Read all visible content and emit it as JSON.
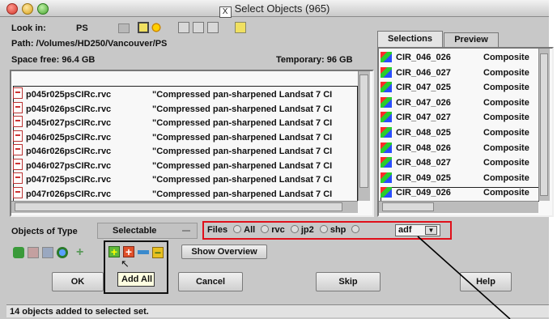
{
  "window": {
    "title": "Select Objects (965)"
  },
  "lookin": {
    "label": "Look in:",
    "value": "PS"
  },
  "path": "Path: /Volumes/HD250/Vancouver/PS",
  "space_free": "Space free: 96.4 GB",
  "temporary": "Temporary: 96 GB",
  "files": [
    {
      "name": "p045r025psCIRc.rvc",
      "desc": "\"Compressed pan-sharpened Landsat 7 CI"
    },
    {
      "name": "p045r026psCIRc.rvc",
      "desc": "\"Compressed pan-sharpened Landsat 7 CI"
    },
    {
      "name": "p045r027psCIRc.rvc",
      "desc": "\"Compressed pan-sharpened Landsat 7 CI"
    },
    {
      "name": "p046r025psCIRc.rvc",
      "desc": "\"Compressed pan-sharpened Landsat 7 CI"
    },
    {
      "name": "p046r026psCIRc.rvc",
      "desc": "\"Compressed pan-sharpened Landsat 7 CI"
    },
    {
      "name": "p046r027psCIRc.rvc",
      "desc": "\"Compressed pan-sharpened Landsat 7 CI"
    },
    {
      "name": "p047r025psCIRc.rvc",
      "desc": "\"Compressed pan-sharpened Landsat 7 CI"
    },
    {
      "name": "p047r026psCIRc.rvc",
      "desc": "\"Compressed pan-sharpened Landsat 7 CI"
    }
  ],
  "tabs": {
    "selections": "Selections",
    "preview": "Preview"
  },
  "selections": [
    {
      "name": "CIR_046_026",
      "type": "Composite"
    },
    {
      "name": "CIR_046_027",
      "type": "Composite"
    },
    {
      "name": "CIR_047_025",
      "type": "Composite"
    },
    {
      "name": "CIR_047_026",
      "type": "Composite"
    },
    {
      "name": "CIR_047_027",
      "type": "Composite"
    },
    {
      "name": "CIR_048_025",
      "type": "Composite"
    },
    {
      "name": "CIR_048_026",
      "type": "Composite"
    },
    {
      "name": "CIR_048_027",
      "type": "Composite"
    },
    {
      "name": "CIR_049_025",
      "type": "Composite"
    },
    {
      "name": "CIR_049_026",
      "type": "Composite"
    }
  ],
  "objects_of_type": {
    "label": "Objects of Type",
    "value": "Selectable"
  },
  "files_filter": {
    "label": "Files",
    "options": [
      "All",
      "rvc",
      "jp2",
      "shp"
    ],
    "custom": "adf"
  },
  "show_overview": "Show Overview",
  "tooltip": "Add All",
  "buttons": {
    "ok": "OK",
    "cancel": "Cancel",
    "skip": "Skip",
    "help": "Help"
  },
  "status": "14 objects added to selected set.",
  "colors": {
    "highlight": "#e0101a",
    "callout": "#000000"
  }
}
